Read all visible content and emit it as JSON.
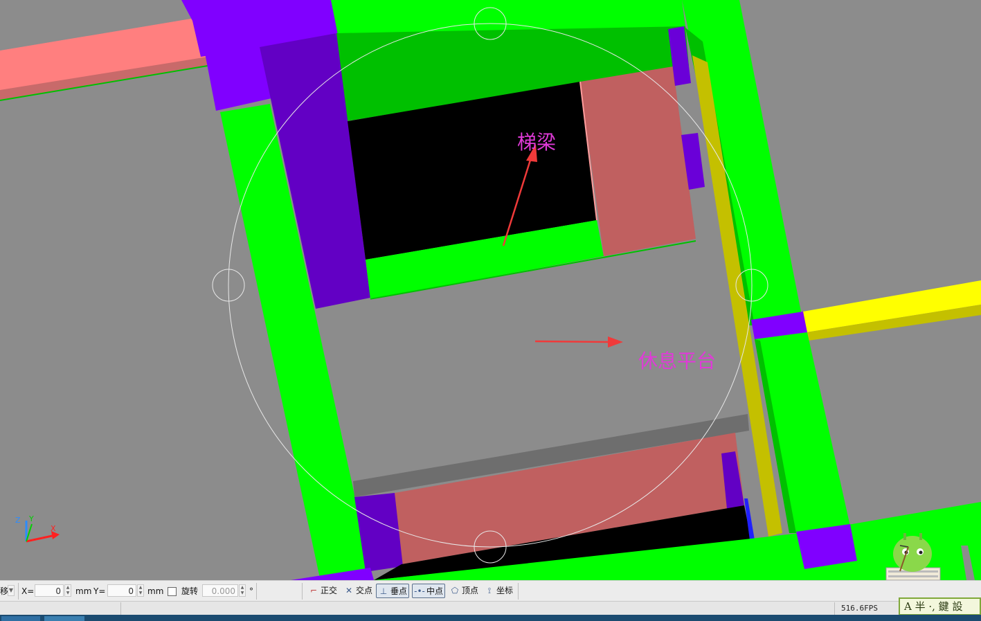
{
  "viewport": {
    "annotations": {
      "stair_beam": "梯梁",
      "landing": "休息平台"
    },
    "axis_labels": {
      "z": "Z",
      "y": "Y",
      "x": "X"
    },
    "colors": {
      "background": "#8c8c8c",
      "column": "#00ff00",
      "slab_edge": "#00c000",
      "beam_purple": "#8000ff",
      "beam_dark_purple": "#6200c4",
      "beam_pink": "#ff7f7f",
      "wall_red": "#c06060",
      "yellow_beam": "#ffff00",
      "olive": "#c4c000",
      "annotation": "#e03ad8",
      "arrow": "#f03a3a"
    }
  },
  "toolbar": {
    "move_label": "移",
    "x_label": "X=",
    "x_value": "0",
    "x_unit": "mm",
    "y_label": "Y=",
    "y_value": "0",
    "y_unit": "mm",
    "rotate_label": "旋转",
    "rotate_value": "0.000",
    "rotate_unit": "°",
    "snaps": [
      {
        "label": "正交",
        "icon": "orthogonal-icon",
        "active": false
      },
      {
        "label": "交点",
        "icon": "intersection-icon",
        "active": false
      },
      {
        "label": "垂点",
        "icon": "perpendicular-icon",
        "active": true
      },
      {
        "label": "中点",
        "icon": "midpoint-icon",
        "active": true
      },
      {
        "label": "顶点",
        "icon": "vertex-icon",
        "active": false
      },
      {
        "label": "坐标",
        "icon": "coordinate-icon",
        "active": false
      }
    ]
  },
  "status": {
    "fps": "516.6FPS",
    "ime_text": "A 半 ·, 鍵 設"
  }
}
